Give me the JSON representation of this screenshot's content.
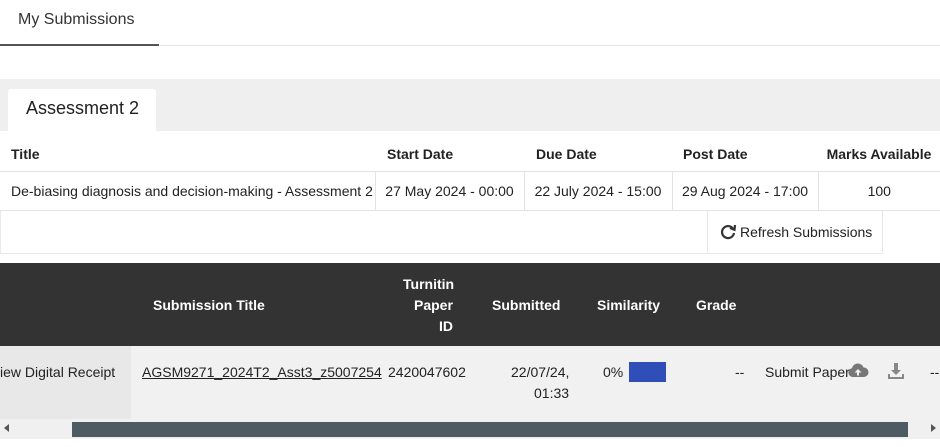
{
  "top_tab": {
    "label": "My Submissions"
  },
  "assessment_tab": {
    "label": "Assessment 2"
  },
  "info_table": {
    "headers": [
      "Title",
      "Start Date",
      "Due Date",
      "Post Date",
      "Marks Available"
    ],
    "row": [
      "De-biasing diagnosis and decision-making - Assessment 2",
      "27 May 2024 - 00:00",
      "22 July 2024 - 15:00",
      "29 Aug 2024 - 17:00",
      "100"
    ]
  },
  "refresh": {
    "label": "Refresh Submissions",
    "icon": "refresh-icon"
  },
  "submissions": {
    "headers": {
      "title": "Submission Title",
      "paper_id_1": "Turnitin",
      "paper_id_2": "Paper",
      "paper_id_3": "ID",
      "submitted": "Submitted",
      "similarity": "Similarity",
      "grade": "Grade"
    },
    "row": {
      "receipt": "iew Digital Receipt",
      "title": "AGSM9271_2024T2_Asst3_z5007254",
      "paper_id": "2420047602",
      "submitted_1": "22/07/24,",
      "submitted_2": "01:33",
      "similarity": "0%",
      "similarity_color": "#2f4eb8",
      "grade": "--",
      "submit_label": "Submit Paper",
      "submit_icon": "cloud-upload-icon",
      "download_icon": "download-icon",
      "more": "--"
    }
  }
}
